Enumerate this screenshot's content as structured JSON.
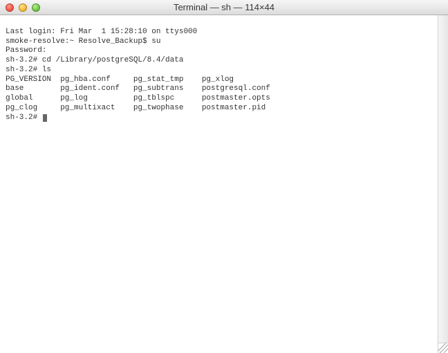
{
  "titlebar": {
    "title": "Terminal — sh — 114×44"
  },
  "session": {
    "last_login": "Last login: Fri Mar  1 15:28:10 on ttys000",
    "prompt1": "smoke-resolve:~ Resolve_Backup$ su",
    "password_line": "Password:",
    "prompt2": "sh-3.2# cd /Library/postgreSQL/8.4/data",
    "prompt3": "sh-3.2# ls",
    "prompt4": "sh-3.2# "
  },
  "ls_output": {
    "rows": [
      {
        "c1": "PG_VERSION",
        "c2": "pg_hba.conf",
        "c3": "pg_stat_tmp",
        "c4": "pg_xlog"
      },
      {
        "c1": "base",
        "c2": "pg_ident.conf",
        "c3": "pg_subtrans",
        "c4": "postgresql.conf"
      },
      {
        "c1": "global",
        "c2": "pg_log",
        "c3": "pg_tblspc",
        "c4": "postmaster.opts"
      },
      {
        "c1": "pg_clog",
        "c2": "pg_multixact",
        "c3": "pg_twophase",
        "c4": "postmaster.pid"
      }
    ]
  }
}
